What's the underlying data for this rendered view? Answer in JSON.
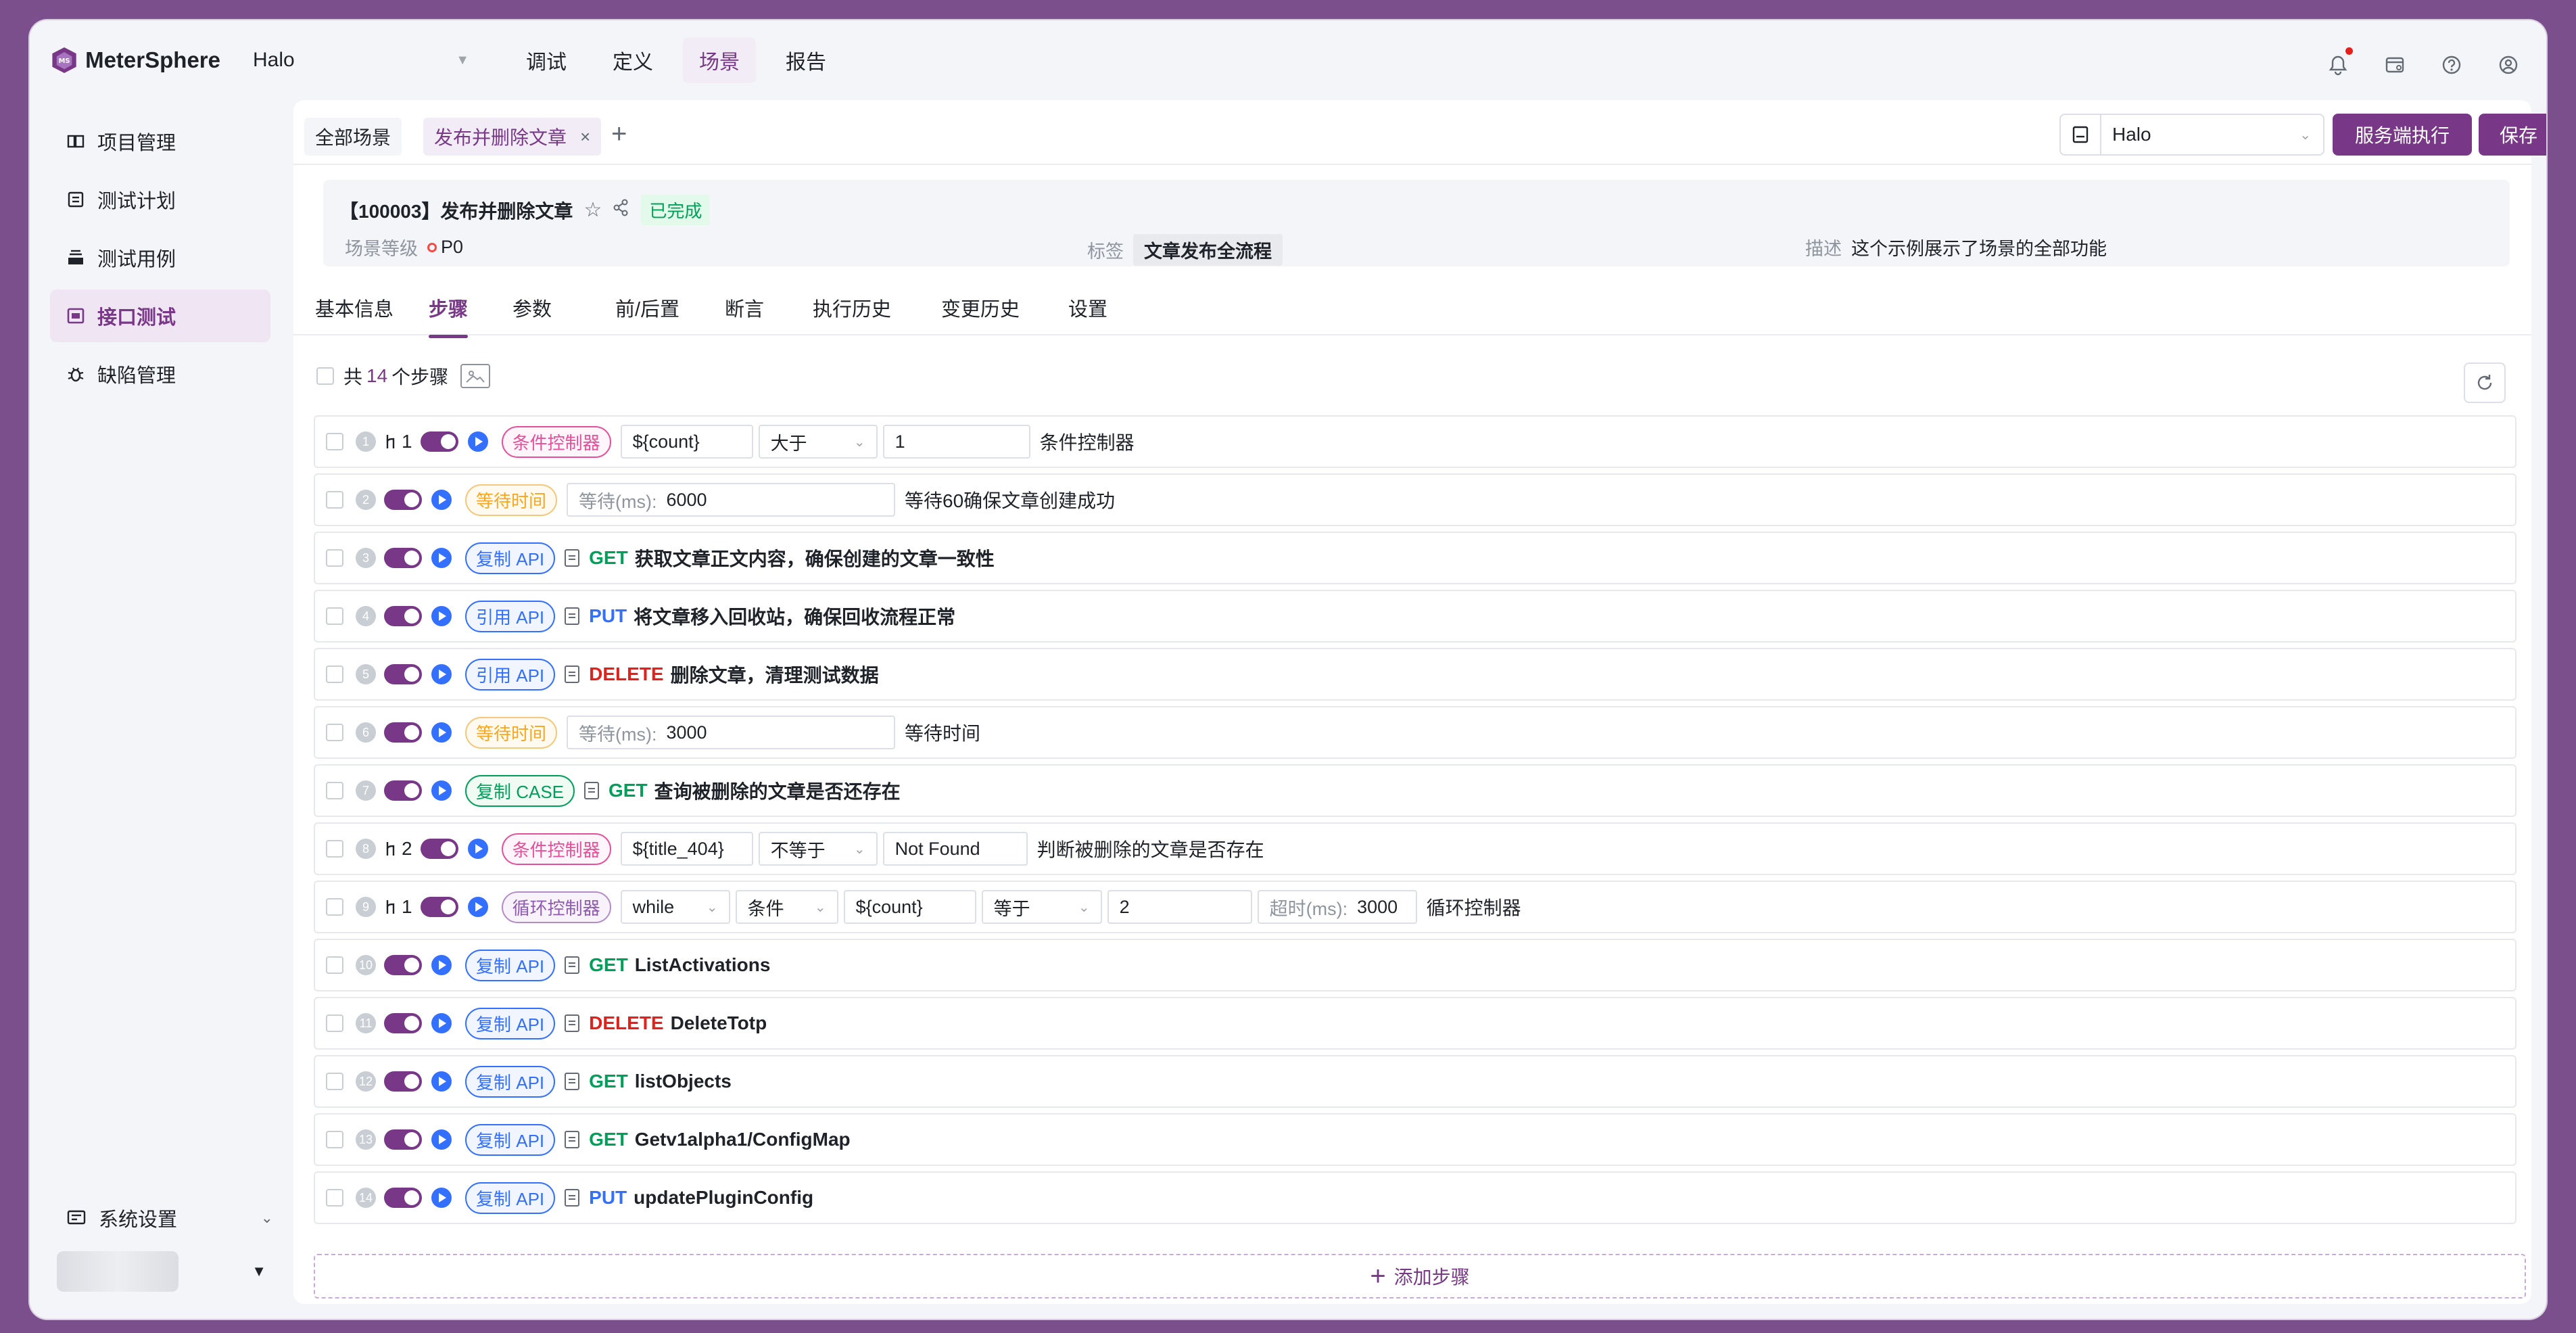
{
  "app": {
    "brand": "MeterSphere",
    "project": "Halo",
    "nav": [
      "调试",
      "定义",
      "场景",
      "报告"
    ],
    "nav_active": 2,
    "accent": "#783887"
  },
  "sidebar": {
    "items": [
      {
        "label": "项目管理",
        "icon": "project-icon"
      },
      {
        "label": "测试计划",
        "icon": "plan-icon"
      },
      {
        "label": "测试用例",
        "icon": "case-icon"
      },
      {
        "label": "接口测试",
        "icon": "api-icon"
      },
      {
        "label": "缺陷管理",
        "icon": "bug-icon"
      }
    ],
    "active": 3,
    "settings": "系统设置"
  },
  "tabs": {
    "all": "全部场景",
    "current": "发布并删除文章",
    "close": "×",
    "add": "+"
  },
  "toolbar": {
    "env": "Halo",
    "run": "服务端执行",
    "save": "保存"
  },
  "scene": {
    "title": "【100003】发布并删除文章",
    "status": "已完成",
    "level_label": "场景等级",
    "level": "P0",
    "tag_label": "标签",
    "tag": "文章发布全流程",
    "desc_label": "描述",
    "desc": "这个示例展示了场景的全部功能"
  },
  "detail_tabs": [
    "基本信息",
    "步骤",
    "参数",
    "前/后置",
    "断言",
    "执行历史",
    "变更历史",
    "设置"
  ],
  "detail_tab_active": 1,
  "steps_head": {
    "prefix": "共",
    "count": "14",
    "suffix": "个步骤"
  },
  "steps": [
    {
      "no": "1",
      "child": "1",
      "type": "cond",
      "badge": "条件控制器",
      "var": "${count}",
      "op": "大于",
      "value": "1",
      "desc": "条件控制器"
    },
    {
      "no": "2",
      "type": "wait",
      "badge": "等待时间",
      "wait_label": "等待(ms):",
      "wait": "6000",
      "desc": "等待60确保文章创建成功"
    },
    {
      "no": "3",
      "type": "api",
      "badge": "复制 API",
      "badge_style": "copy",
      "method": "GET",
      "name": "获取文章正文内容，确保创建的文章一致性"
    },
    {
      "no": "4",
      "type": "api",
      "badge": "引用 API",
      "badge_style": "ref",
      "method": "PUT",
      "name": "将文章移入回收站，确保回收流程正常"
    },
    {
      "no": "5",
      "type": "api",
      "badge": "引用 API",
      "badge_style": "ref",
      "method": "DELETE",
      "name": "删除文章，清理测试数据"
    },
    {
      "no": "6",
      "type": "wait",
      "badge": "等待时间",
      "wait_label": "等待(ms):",
      "wait": "3000",
      "desc": "等待时间"
    },
    {
      "no": "7",
      "type": "api",
      "badge": "复制 CASE",
      "badge_style": "case",
      "method": "GET",
      "name": "查询被删除的文章是否还存在"
    },
    {
      "no": "8",
      "child": "2",
      "type": "cond",
      "badge": "条件控制器",
      "var": "${title_404}",
      "op": "不等于",
      "value": "Not Found",
      "desc": "判断被删除的文章是否存在"
    },
    {
      "no": "9",
      "child": "1",
      "type": "loop",
      "badge": "循环控制器",
      "loop": "while",
      "cond": "条件",
      "var": "${count}",
      "op": "等于",
      "value": "2",
      "timeout_label": "超时(ms):",
      "timeout": "3000",
      "desc": "循环控制器"
    },
    {
      "no": "10",
      "type": "api",
      "badge": "复制 API",
      "badge_style": "copy",
      "method": "GET",
      "name": "ListActivations"
    },
    {
      "no": "11",
      "type": "api",
      "badge": "复制 API",
      "badge_style": "copy",
      "method": "DELETE",
      "name": "DeleteTotp"
    },
    {
      "no": "12",
      "type": "api",
      "badge": "复制 API",
      "badge_style": "copy",
      "method": "GET",
      "name": "listObjects"
    },
    {
      "no": "13",
      "type": "api",
      "badge": "复制 API",
      "badge_style": "copy",
      "method": "GET",
      "name": "Getv1alpha1/ConfigMap"
    },
    {
      "no": "14",
      "type": "api",
      "badge": "复制 API",
      "badge_style": "copy",
      "method": "PUT",
      "name": "updatePluginConfig"
    }
  ],
  "add_step": "添加步骤"
}
